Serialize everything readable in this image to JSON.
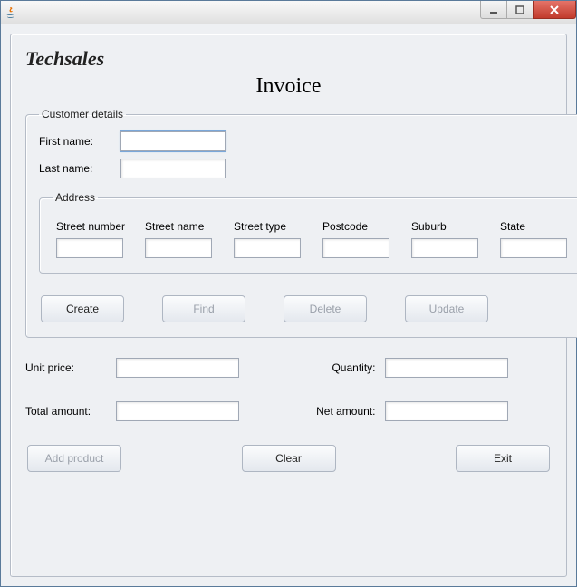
{
  "window": {
    "title": ""
  },
  "brand": "Techsales",
  "page_title": "Invoice",
  "customer": {
    "legend": "Customer details",
    "first_name_label": "First name:",
    "last_name_label": "Last name:",
    "first_name": "",
    "last_name": "",
    "address": {
      "legend": "Address",
      "cols": {
        "street_number": "Street number",
        "street_name": "Street name",
        "street_type": "Street type",
        "postcode": "Postcode",
        "suburb": "Suburb",
        "state": "State"
      },
      "values": {
        "street_number": "",
        "street_name": "",
        "street_type": "",
        "postcode": "",
        "suburb": "",
        "state": ""
      }
    },
    "buttons": {
      "create": "Create",
      "find": "Find",
      "delete": "Delete",
      "update": "Update"
    }
  },
  "pricing": {
    "unit_price_label": "Unit price:",
    "quantity_label": "Quantity:",
    "total_amount_label": "Total amount:",
    "net_amount_label": "Net amount:",
    "unit_price": "",
    "quantity": "",
    "total_amount": "",
    "net_amount": ""
  },
  "bottom_buttons": {
    "add_product": "Add product",
    "clear": "Clear",
    "exit": "Exit"
  }
}
